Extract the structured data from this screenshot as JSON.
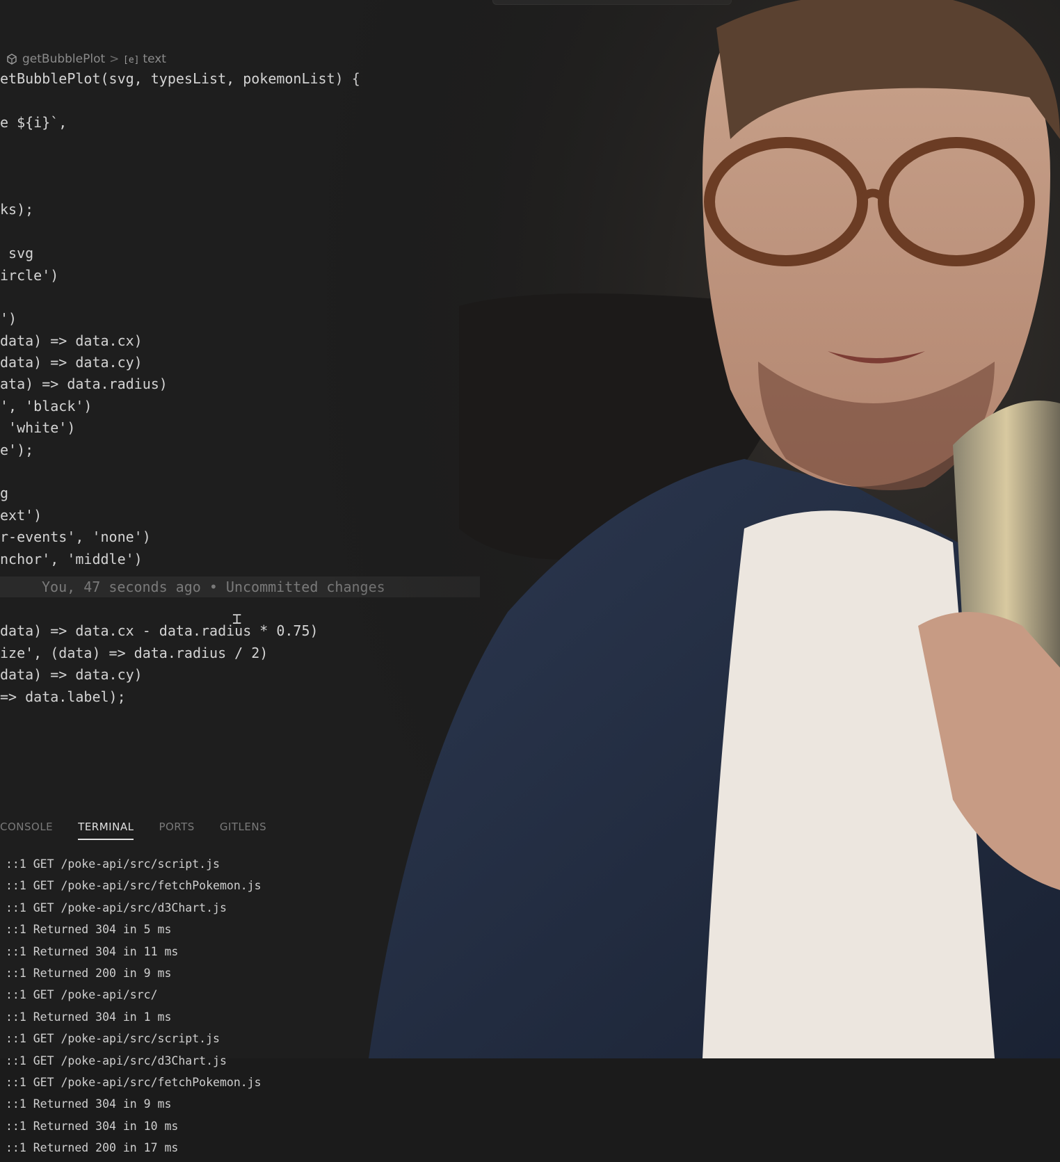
{
  "breadcrumb": {
    "items": [
      "getBubblePlot",
      "text"
    ],
    "separator": ">"
  },
  "code": {
    "lines": [
      "etBubblePlot(svg, typesList, pokemonList) {",
      "",
      "e ${i}`,",
      "",
      "",
      "",
      "ks);",
      "",
      " svg",
      "ircle')",
      "",
      "')",
      "data) => data.cx)",
      "data) => data.cy)",
      "ata) => data.radius)",
      "', 'black')",
      " 'white')",
      "e');",
      "",
      "g",
      "ext')",
      "r-events', 'none')",
      "nchor', 'middle')"
    ],
    "blame": "You, 47 seconds ago • Uncommitted changes",
    "lines_after": [
      "",
      "data) => data.cx - data.radius * 0.75)",
      "ize', (data) => data.radius / 2)",
      "data) => data.cy)",
      "=> data.label);"
    ]
  },
  "panel": {
    "tabs": [
      "CONSOLE",
      "TERMINAL",
      "PORTS",
      "GITLENS"
    ],
    "active_tab": "TERMINAL"
  },
  "terminal": {
    "lines": [
      "::1 GET /poke-api/src/script.js",
      "::1 GET /poke-api/src/fetchPokemon.js",
      "::1 GET /poke-api/src/d3Chart.js",
      "::1 Returned 304 in 5 ms",
      "::1 Returned 304 in 11 ms",
      "::1 Returned 200 in 9 ms",
      "::1 GET /poke-api/src/",
      "::1 Returned 304 in 1 ms",
      "::1 GET /poke-api/src/script.js",
      "::1 GET /poke-api/src/d3Chart.js",
      "::1 GET /poke-api/src/fetchPokemon.js",
      "::1 Returned 304 in 9 ms",
      "::1 Returned 304 in 10 ms",
      "::1 Returned 200 in 17 ms"
    ]
  },
  "colors": {
    "editor_bg": "#1e1e1e",
    "text": "#d4d4d4",
    "string": "#ce9178",
    "keyword": "#c586c0",
    "function": "#dcdcaa",
    "bracket": "#e8b84a"
  },
  "icons": [
    "symbol-method-icon",
    "symbol-variable-icon"
  ]
}
